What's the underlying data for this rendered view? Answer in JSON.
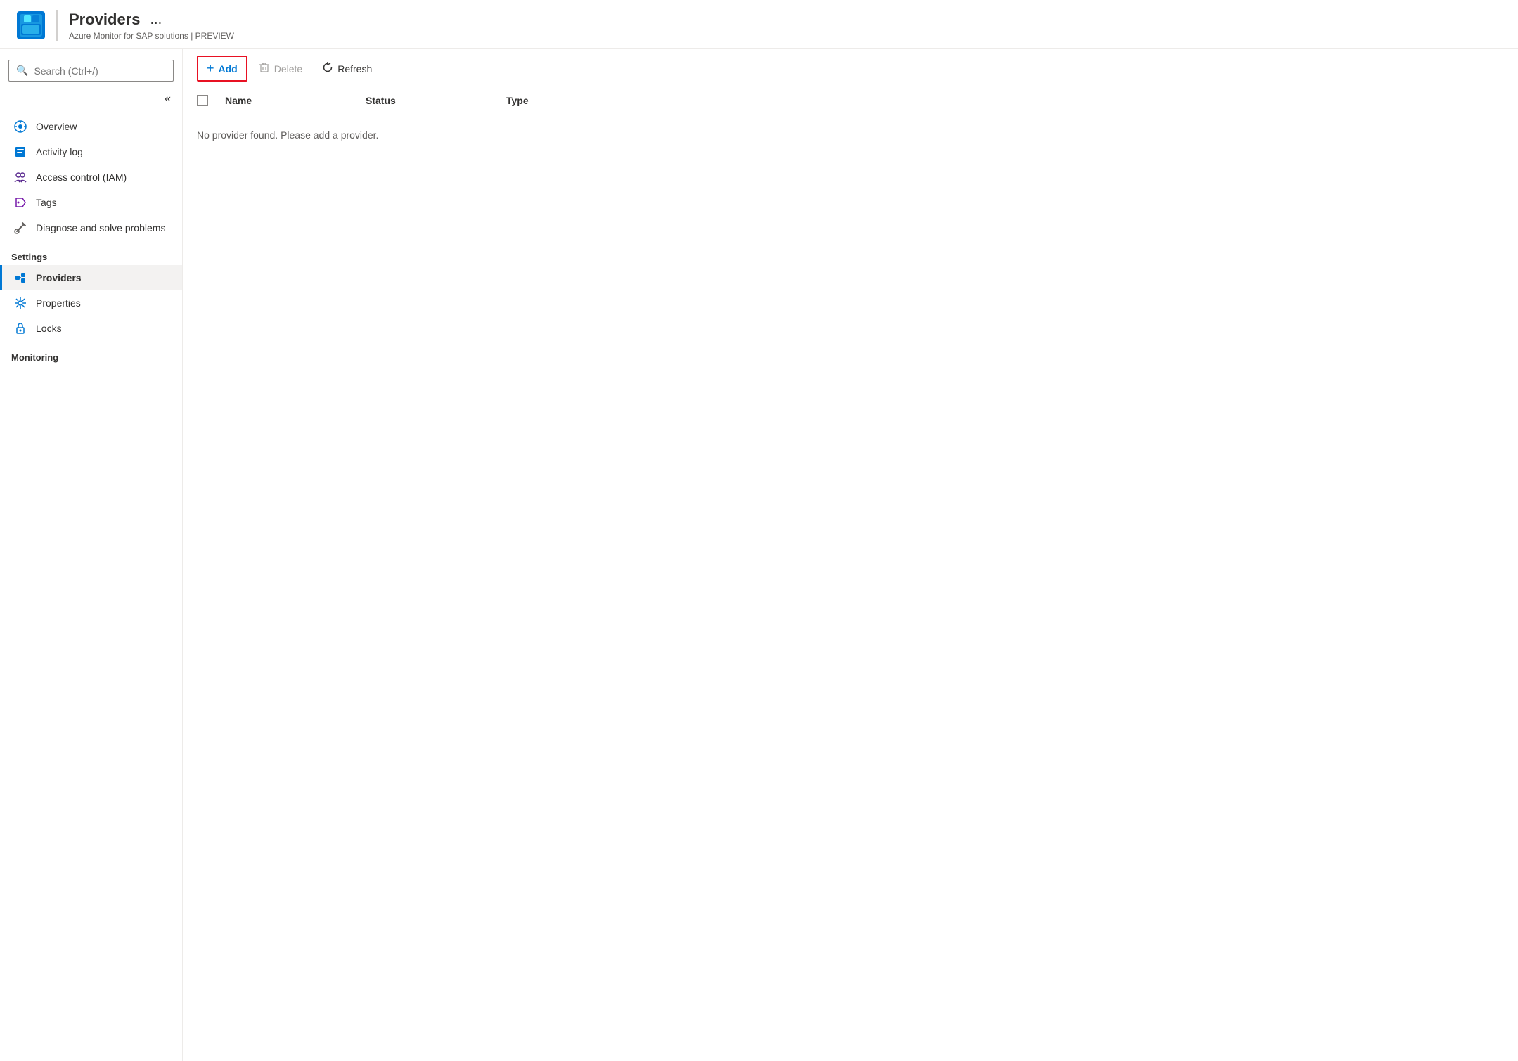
{
  "header": {
    "title": "Providers",
    "subtitle": "Azure Monitor for SAP solutions | PREVIEW",
    "ellipsis_label": "...",
    "logo_aria": "Azure Monitor for SAP solutions logo"
  },
  "sidebar": {
    "search_placeholder": "Search (Ctrl+/)",
    "collapse_icon": "«",
    "nav_items": [
      {
        "id": "overview",
        "label": "Overview",
        "icon": "🌐",
        "active": false,
        "section": null
      },
      {
        "id": "activity-log",
        "label": "Activity log",
        "icon": "📋",
        "active": false,
        "section": null
      },
      {
        "id": "access-control",
        "label": "Access control (IAM)",
        "icon": "👥",
        "active": false,
        "section": null
      },
      {
        "id": "tags",
        "label": "Tags",
        "icon": "🏷",
        "active": false,
        "section": null
      },
      {
        "id": "diagnose",
        "label": "Diagnose and solve problems",
        "icon": "🔧",
        "active": false,
        "section": null
      }
    ],
    "sections": [
      {
        "id": "settings",
        "label": "Settings",
        "items": [
          {
            "id": "providers",
            "label": "Providers",
            "icon": "🔗",
            "active": true
          },
          {
            "id": "properties",
            "label": "Properties",
            "icon": "⚙",
            "active": false
          },
          {
            "id": "locks",
            "label": "Locks",
            "icon": "🔒",
            "active": false
          }
        ]
      },
      {
        "id": "monitoring",
        "label": "Monitoring",
        "items": []
      }
    ]
  },
  "toolbar": {
    "add_label": "Add",
    "delete_label": "Delete",
    "refresh_label": "Refresh",
    "add_icon": "+",
    "delete_icon": "🗑",
    "refresh_icon": "↺"
  },
  "table": {
    "columns": [
      {
        "id": "checkbox",
        "label": ""
      },
      {
        "id": "name",
        "label": "Name"
      },
      {
        "id": "status",
        "label": "Status"
      },
      {
        "id": "type",
        "label": "Type"
      }
    ],
    "empty_message": "No provider found. Please add a provider."
  }
}
